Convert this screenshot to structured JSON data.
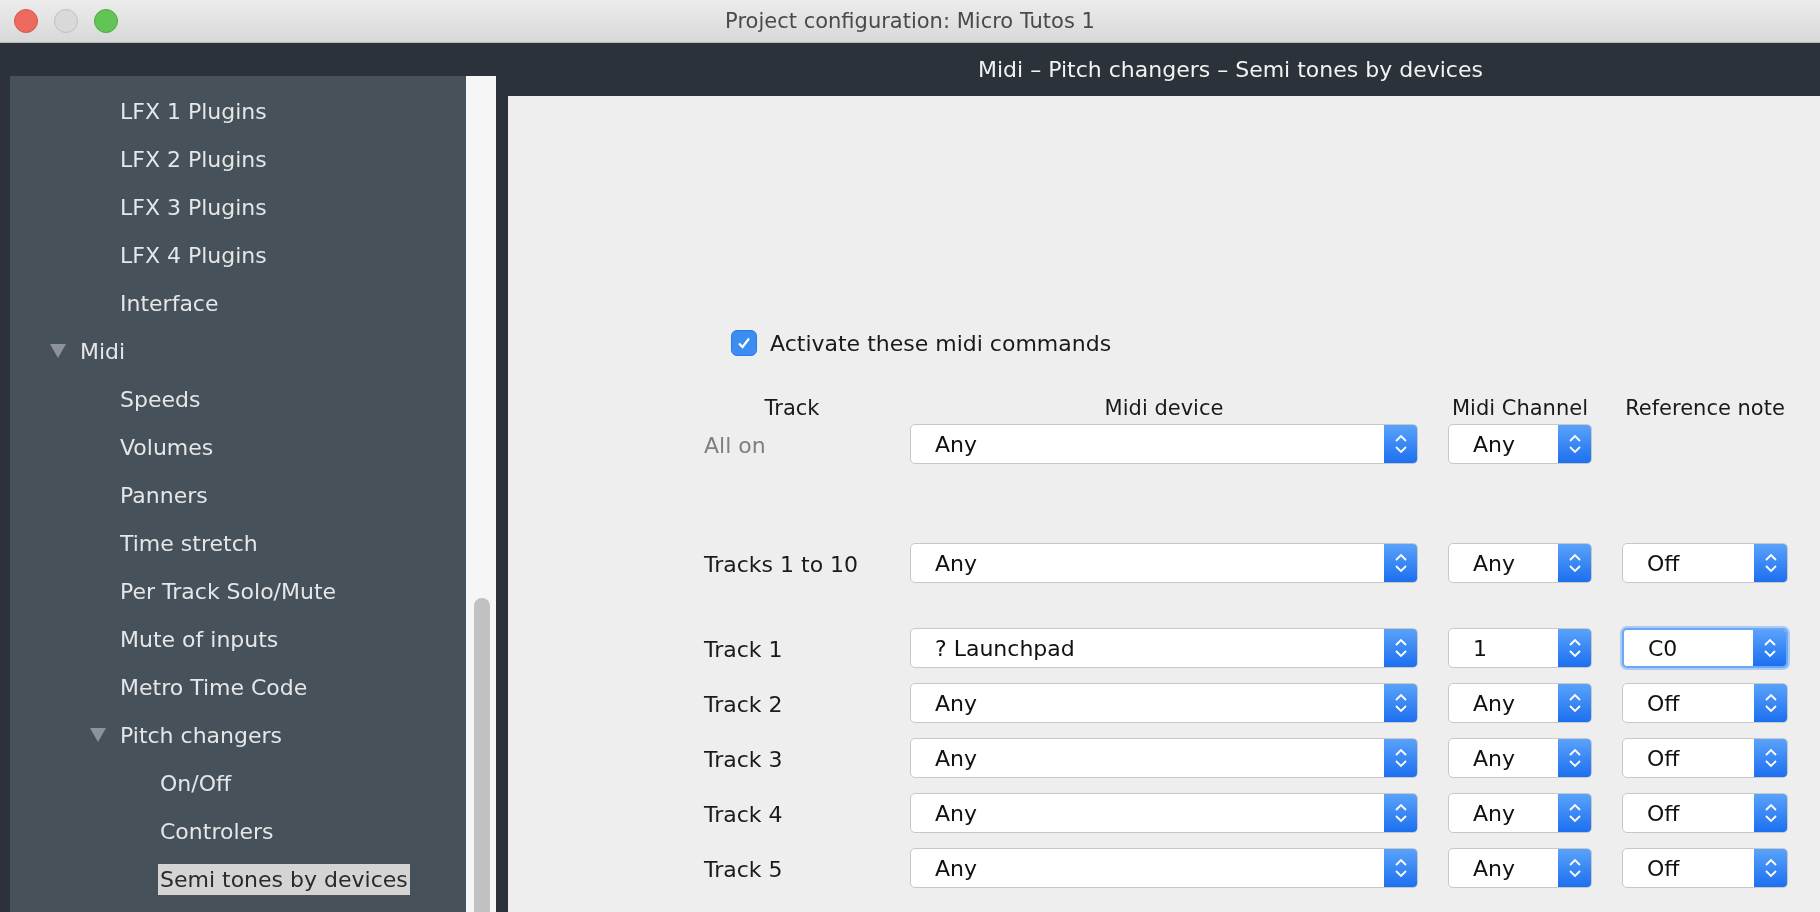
{
  "window": {
    "title": "Project configuration: Micro Tutos 1"
  },
  "sidebar": {
    "items": [
      {
        "label": "LFX 1 Plugins",
        "selected": false
      },
      {
        "label": "LFX 2 Plugins",
        "selected": false
      },
      {
        "label": "LFX 3 Plugins",
        "selected": false
      },
      {
        "label": "LFX 4 Plugins",
        "selected": false
      },
      {
        "label": "Interface",
        "selected": false
      },
      {
        "label": "Midi",
        "selected": false,
        "expanded": true,
        "children": [
          {
            "label": "Speeds",
            "selected": false
          },
          {
            "label": "Volumes",
            "selected": false
          },
          {
            "label": "Panners",
            "selected": false
          },
          {
            "label": "Time stretch",
            "selected": false
          },
          {
            "label": "Per Track Solo/Mute",
            "selected": false
          },
          {
            "label": "Mute of inputs",
            "selected": false
          },
          {
            "label": "Metro Time Code",
            "selected": false
          },
          {
            "label": "Pitch changers",
            "selected": false,
            "expanded": true,
            "children": [
              {
                "label": "On/Off",
                "selected": false
              },
              {
                "label": "Controlers",
                "selected": false
              },
              {
                "label": "Semi tones by devices",
                "selected": true
              }
            ]
          }
        ]
      }
    ]
  },
  "panel": {
    "header": "Midi – Pitch changers – Semi tones by devices",
    "activate": {
      "label": "Activate these midi commands",
      "checked": true
    },
    "columns": [
      "Track",
      "Midi device",
      "Midi Channel",
      "Reference note"
    ],
    "all_row": {
      "label": "All on",
      "disabled": true,
      "device": "Any",
      "channel": "Any"
    },
    "group_row": {
      "label": "Tracks 1 to 10",
      "disabled": false,
      "device": "Any",
      "channel": "Any",
      "reference": "Off",
      "focused": false
    },
    "tracks": [
      {
        "label": "Track 1",
        "disabled": false,
        "device": "? Launchpad",
        "channel": "1",
        "reference": "C0",
        "focused": true
      },
      {
        "label": "Track 2",
        "disabled": false,
        "device": "Any",
        "channel": "Any",
        "reference": "Off",
        "focused": false
      },
      {
        "label": "Track 3",
        "disabled": false,
        "device": "Any",
        "channel": "Any",
        "reference": "Off",
        "focused": false
      },
      {
        "label": "Track 4",
        "disabled": false,
        "device": "Any",
        "channel": "Any",
        "reference": "Off",
        "focused": false
      },
      {
        "label": "Track 5",
        "disabled": false,
        "device": "Any",
        "channel": "Any",
        "reference": "Off",
        "focused": false
      }
    ]
  }
}
